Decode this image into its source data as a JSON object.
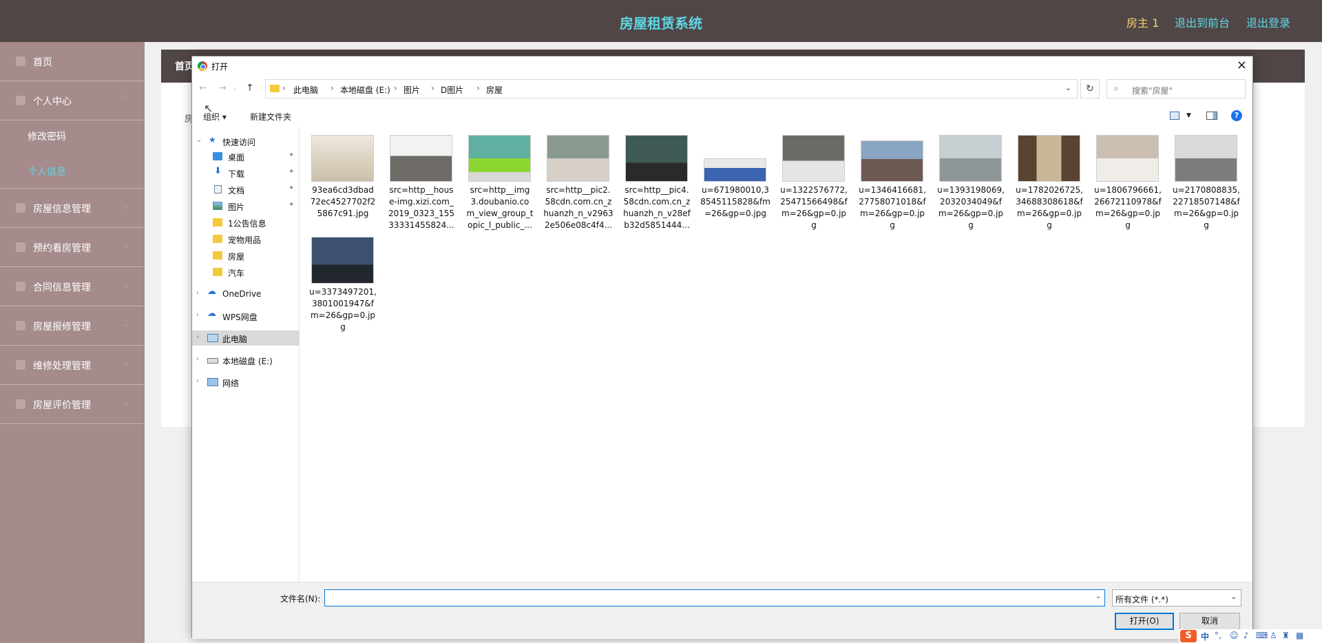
{
  "header": {
    "title": "房屋租赁系统",
    "user": "房主 1",
    "link_front": "退出到前台",
    "link_logout": "退出登录"
  },
  "sidebar": {
    "items": [
      {
        "label": "首页"
      },
      {
        "label": "个人中心"
      },
      {
        "label": "修改密码"
      },
      {
        "label": "个人信息"
      },
      {
        "label": "房屋信息管理"
      },
      {
        "label": "预约看房管理"
      },
      {
        "label": "合同信息管理"
      },
      {
        "label": "房屋报修管理"
      },
      {
        "label": "维修处理管理"
      },
      {
        "label": "房屋评价管理"
      }
    ],
    "active_color": "#5ed8e6"
  },
  "main": {
    "breadcrumb": "首页",
    "peek": "房"
  },
  "dialog": {
    "title": "打开",
    "close": "×",
    "address": [
      "此电脑",
      "本地磁盘 (E:)",
      "图片",
      "D图片",
      "房屋"
    ],
    "search_placeholder": "搜索\"房屋\"",
    "organize": "组织 ▾",
    "new_folder": "新建文件夹",
    "help": "?",
    "tree": [
      {
        "label": "快速访问",
        "icon": "star-icon"
      },
      {
        "label": "桌面",
        "icon": "desktop-icon"
      },
      {
        "label": "下载",
        "icon": "download-icon"
      },
      {
        "label": "文档",
        "icon": "document-icon"
      },
      {
        "label": "图片",
        "icon": "pictures-icon"
      },
      {
        "label": "1公告信息",
        "icon": "folder-icon"
      },
      {
        "label": "宠物用品",
        "icon": "folder-icon"
      },
      {
        "label": "房屋",
        "icon": "folder-icon"
      },
      {
        "label": "汽车",
        "icon": "folder-icon"
      },
      {
        "label": "OneDrive",
        "icon": "cloud-icon"
      },
      {
        "label": "WPS网盘",
        "icon": "cloud-icon"
      },
      {
        "label": "此电脑",
        "icon": "computer-icon"
      },
      {
        "label": "本地磁盘 (E:)",
        "icon": "drive-icon"
      },
      {
        "label": "网络",
        "icon": "network-icon"
      }
    ],
    "files": [
      {
        "line1": "93ea6cd3dbad",
        "line2": "72ec4527702f2",
        "line3": "5867c91.jpg",
        "line4": "",
        "color": "#d8cdbd"
      },
      {
        "line1": "src=http__hous",
        "line2": "e-img.xizi.com_",
        "line3": "2019_0323_155",
        "line4": "33331455824...",
        "color": "#6e6a66"
      },
      {
        "line1": "src=http__img",
        "line2": "3.doubanio.co",
        "line3": "m_view_group_t",
        "line4": "opic_l_public_...",
        "color": "#4a9a7a"
      },
      {
        "line1": "src=http__pic2.",
        "line2": "58cdn.com.cn_z",
        "line3": "huanzh_n_v2963",
        "line4": "2e506e08c4f4...",
        "color": "#6a7a6e"
      },
      {
        "line1": "src=http__pic4.",
        "line2": "58cdn.com.cn_z",
        "line3": "huanzh_n_v28ef",
        "line4": "b32d5851444...",
        "color": "#3f5a55"
      },
      {
        "line1": "u=671980010,3",
        "line2": "8545115828&fm",
        "line3": "=26&gp=0.jpg",
        "line4": "",
        "color": "#5a7aa8"
      },
      {
        "line1": "u=1322576772,",
        "line2": "25471566498&f",
        "line3": "m=26&gp=0.jp",
        "line4": "g",
        "color": "#55534f"
      },
      {
        "line1": "u=1346416681,",
        "line2": "27758071018&f",
        "line3": "m=26&gp=0.jp",
        "line4": "g",
        "color": "#6d5a52"
      },
      {
        "line1": "u=1393198069,",
        "line2": "2032034049&f",
        "line3": "m=26&gp=0.jp",
        "line4": "g",
        "color": "#8e9698"
      },
      {
        "line1": "u=1782026725,",
        "line2": "34688308618&f",
        "line3": "m=26&gp=0.jp",
        "line4": "g",
        "color": "#5a4333"
      },
      {
        "line1": "u=1806796661,",
        "line2": "26672110978&f",
        "line3": "m=26&gp=0.jp",
        "line4": "g",
        "color": "#a89c92"
      },
      {
        "line1": "u=2170808835,",
        "line2": "22718507148&f",
        "line3": "m=26&gp=0.jp",
        "line4": "g",
        "color": "#7c7c7e"
      },
      {
        "line1": "u=3373497201,",
        "line2": "3801001947&f",
        "line3": "m=26&gp=0.jp",
        "line4": "g",
        "color": "#3d5070"
      }
    ],
    "filename_label": "文件名(N):",
    "filename_value": "",
    "filetype": "所有文件 (*.*)",
    "open_button": "打开(O)",
    "cancel_button": "取消"
  },
  "ime": {
    "logo": "S",
    "mode": "中"
  }
}
